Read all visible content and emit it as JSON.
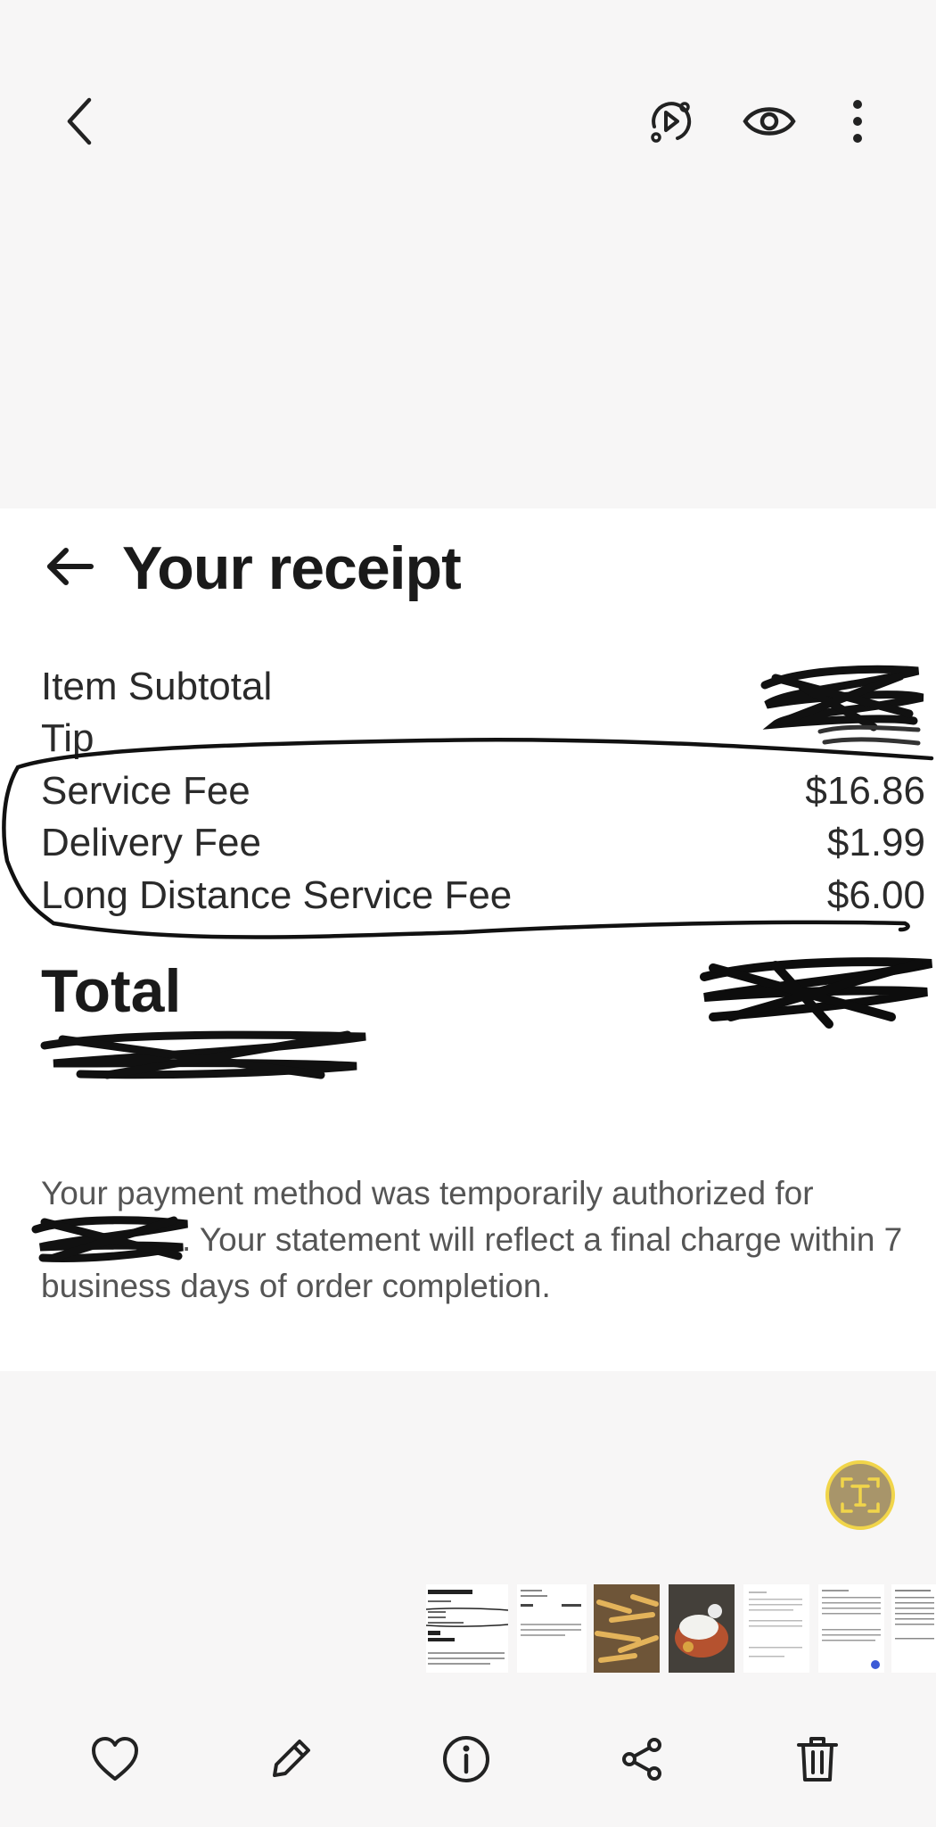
{
  "toolbar": {
    "back_icon": "chevron-left-icon",
    "icons": [
      "motion-photo-icon",
      "eye-icon",
      "more-vert-icon"
    ]
  },
  "receipt": {
    "title": "Your receipt",
    "rows": [
      {
        "label": "Item Subtotal",
        "value": ""
      },
      {
        "label": "Tip",
        "value": ""
      },
      {
        "label": "Service Fee",
        "value": "$16.86"
      },
      {
        "label": "Delivery Fee",
        "value": "$1.99"
      },
      {
        "label": "Long Distance Service Fee",
        "value": "$6.00"
      }
    ],
    "total_label": "Total",
    "note_text": ". Your statement will reflect a final charge within 7 business days of order completion.",
    "note_first_line": "Your payment method was temporarily authorized for"
  },
  "bottom_bar": {
    "icons": [
      "heart-icon",
      "edit-pencil-icon",
      "info-icon",
      "share-icon",
      "trash-icon"
    ]
  },
  "colors": {
    "background": "#f7f6f6",
    "photo": "#ffffff",
    "ocr_ring": "#f1d54a"
  }
}
